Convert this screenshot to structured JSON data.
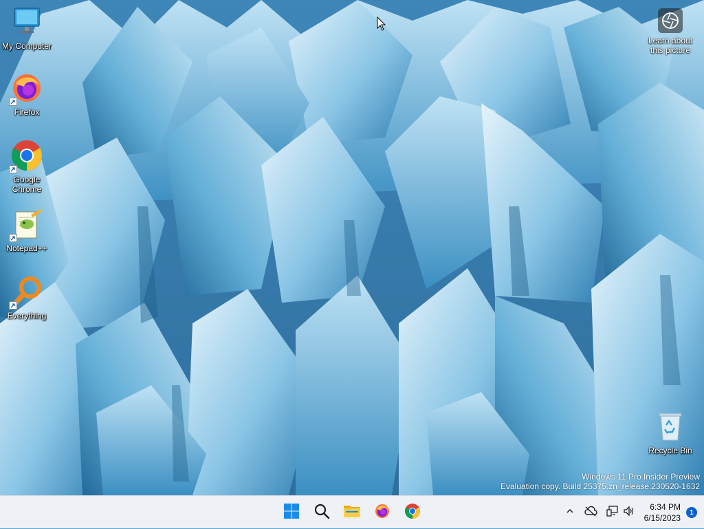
{
  "desktop": {
    "icons": [
      {
        "label": "My Computer",
        "icon": "computer-icon"
      },
      {
        "label": "Firefox",
        "icon": "firefox-icon"
      },
      {
        "label": "Google Chrome",
        "icon": "chrome-icon"
      },
      {
        "label": "Notepad++",
        "icon": "notepad-plus-plus-icon"
      },
      {
        "label": "Everything",
        "icon": "everything-search-icon"
      },
      {
        "label": "Recycle Bin",
        "icon": "recycle-bin-icon"
      }
    ],
    "learn_about": {
      "label": "Learn about this picture",
      "icon": "camera-aperture-icon"
    },
    "watermark": {
      "line1": "Windows 11 Pro Insider Preview",
      "line2": "Evaluation copy. Build 25375.zn_release.230520-1632"
    }
  },
  "taskbar": {
    "apps": [
      {
        "name": "Start",
        "icon": "windows-start-icon"
      },
      {
        "name": "Search",
        "icon": "search-icon"
      },
      {
        "name": "File Explorer",
        "icon": "folder-icon"
      },
      {
        "name": "Firefox",
        "icon": "firefox-icon"
      },
      {
        "name": "Google Chrome",
        "icon": "chrome-icon"
      }
    ],
    "tray": {
      "icons": [
        "chevron-up-icon",
        "onedrive-offline-icon",
        "network-icon",
        "volume-icon"
      ],
      "time": "6:34 PM",
      "date": "6/15/2023",
      "notification_count": "1"
    }
  },
  "colors": {
    "taskbar_bg": "#eef1f6",
    "accent": "#0a5fd1",
    "ice_light": "#d9eef8",
    "ice_mid": "#5aa6d0",
    "ice_dark": "#1e5f8a"
  }
}
